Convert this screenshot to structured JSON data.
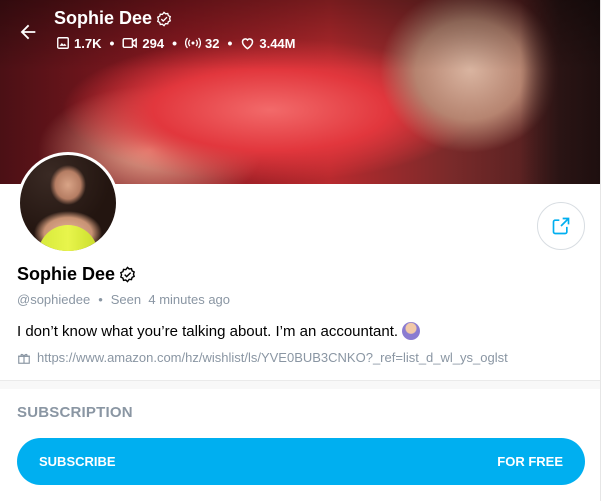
{
  "header": {
    "name": "Sophie Dee",
    "stats": {
      "photos": "1.7K",
      "videos": "294",
      "streams": "32",
      "likes": "3.44M"
    }
  },
  "profile": {
    "name": "Sophie Dee",
    "username": "@sophiedee",
    "separator": "•",
    "seen": "Seen  4 minutes ago",
    "bio": "I don’t know what you’re talking about. I’m an accountant.",
    "link": "https://www.amazon.com/hz/wishlist/ls/YVE0BUB3CNKO?_ref=list_d_wl_ys_oglst"
  },
  "subscription": {
    "title": "SUBSCRIPTION",
    "button_label": "SUBSCRIBE",
    "button_price": "FOR FREE"
  },
  "colors": {
    "accent": "#00aff0",
    "muted": "#8a96a3"
  },
  "icons": [
    "back-arrow-icon",
    "verified-icon",
    "photo-icon",
    "video-icon",
    "stream-icon",
    "heart-icon",
    "share-icon",
    "gift-icon"
  ]
}
